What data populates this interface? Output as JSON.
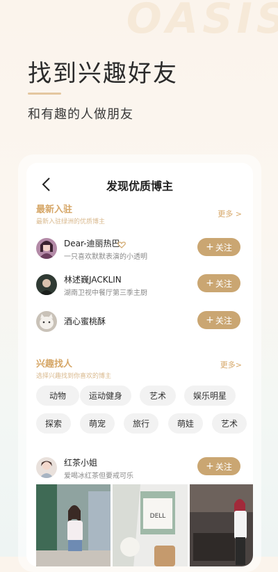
{
  "hero": {
    "watermark": "OASIS",
    "title": "找到兴趣好友",
    "subtitle": "和有趣的人做朋友"
  },
  "nav": {
    "title": "发现优质博主"
  },
  "new_section": {
    "title": "最新入驻",
    "desc": "最新入驻绿洲的优质博主",
    "more": "更多 >",
    "users": [
      {
        "name": "Dear-迪丽热巴",
        "desc": "一只喜欢默默表演的小透明",
        "follow": "关注"
      },
      {
        "name": "林述巍JACKLIN",
        "desc": "湖南卫视中餐厅第三季主厨",
        "follow": "关注"
      },
      {
        "name": "酒心蜜桃酥",
        "desc": "",
        "follow": "关注"
      }
    ]
  },
  "interest_section": {
    "title": "兴趣找人",
    "desc": "选择兴趣找到你喜欢的博主",
    "more": "更多>",
    "tags_row1": [
      "动物",
      "运动健身",
      "艺术",
      "娱乐明星"
    ],
    "tags_row2": [
      "探索",
      "萌宠",
      "旅行",
      "萌娃",
      "艺术"
    ]
  },
  "featured_user": {
    "name": "红茶小姐",
    "desc": "爱喝冰红茶但要戒可乐",
    "follow": "关注"
  },
  "colors": {
    "accent": "#caa672",
    "section_title": "#d6a768"
  },
  "icons": {
    "back": "chevron-left-icon",
    "verified": "heart-badge-icon",
    "plus": "plus-icon"
  }
}
